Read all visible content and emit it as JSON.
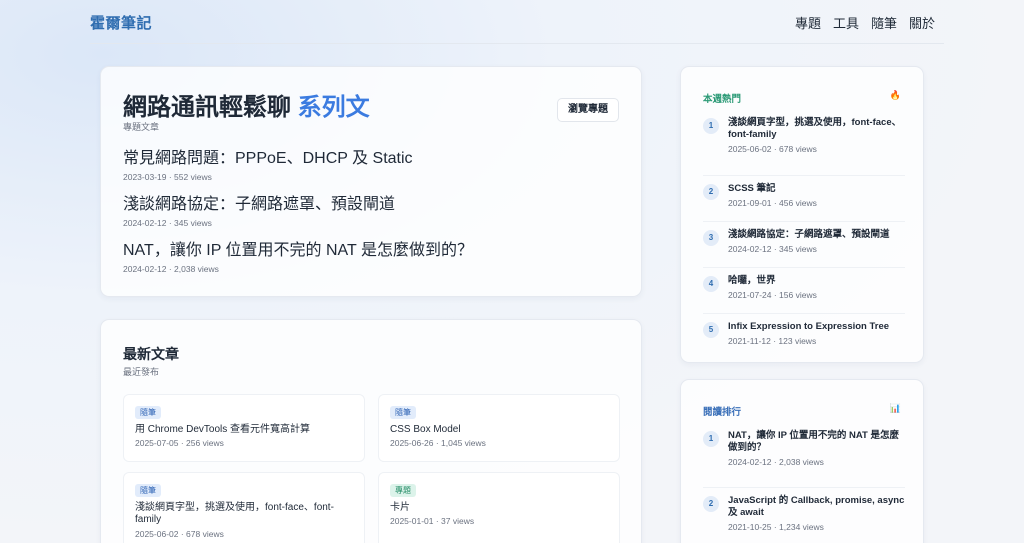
{
  "site": {
    "brand": "霍爾筆記"
  },
  "nav": [
    "專題",
    "工具",
    "隨筆",
    "關於"
  ],
  "series": {
    "title_main": "網路通訊輕鬆聊",
    "title_accent": "系列文",
    "subtitle": "專題文章",
    "browse_label": "瀏覽專題",
    "items": [
      {
        "title": "常見網路問題：PPPoE、DHCP 及 Static",
        "meta": "2023-03-19 · 552 views"
      },
      {
        "title": "淺談網路協定：子網路遮罩、預設閘道",
        "meta": "2024-02-12 · 345 views"
      },
      {
        "title": "NAT，讓你 IP 位置用不完的 NAT 是怎麼做到的？",
        "meta": "2024-02-12 · 2,038 views"
      }
    ]
  },
  "latest": {
    "title": "最新文章",
    "subtitle": "最近發布",
    "items": [
      {
        "tag": "隨筆",
        "title": "用 Chrome DevTools 查看元件寬高計算",
        "meta": "2025-07-05 · 256 views"
      },
      {
        "tag": "隨筆",
        "title": "CSS Box Model",
        "meta": "2025-06-26 · 1,045 views"
      },
      {
        "tag": "隨筆",
        "title": "淺談網頁字型，挑選及使用，font-face、font-family",
        "meta": "2025-06-02 · 678 views"
      },
      {
        "tag": "專題",
        "title": "卡片",
        "meta": "2025-01-01 · 37 views"
      }
    ]
  },
  "hot": {
    "title": "本週熱門",
    "icon": "fire-icon",
    "items": [
      {
        "num": "1",
        "title": "淺談網頁字型，挑選及使用，font-face、font-family",
        "meta": "2025-06-02 · 678 views"
      },
      {
        "num": "2",
        "title": "SCSS 筆記",
        "meta": "2021-09-01 · 456 views"
      },
      {
        "num": "3",
        "title": "淺談網路協定：子網路遮罩、預設閘道",
        "meta": "2024-02-12 · 345 views"
      },
      {
        "num": "4",
        "title": "哈囉，世界",
        "meta": "2021-07-24 · 156 views"
      },
      {
        "num": "5",
        "title": "Infix Expression to Expression Tree",
        "meta": "2021-11-12 · 123 views"
      }
    ]
  },
  "ranking": {
    "title": "閱讀排行",
    "icon": "bar-chart-icon",
    "items": [
      {
        "num": "1",
        "title": "NAT，讓你 IP 位置用不完的 NAT 是怎麼做到的？",
        "meta": "2024-02-12 · 2,038 views"
      },
      {
        "num": "2",
        "title": "JavaScript 的 Callback, promise, async 及 await",
        "meta": "2021-10-25 · 1,234 views"
      }
    ]
  },
  "colors": {
    "brand": "#2f6db0",
    "accent": "#3b7be0",
    "hot_head": "#2b9a76",
    "rank_head": "#3a6fb8"
  }
}
